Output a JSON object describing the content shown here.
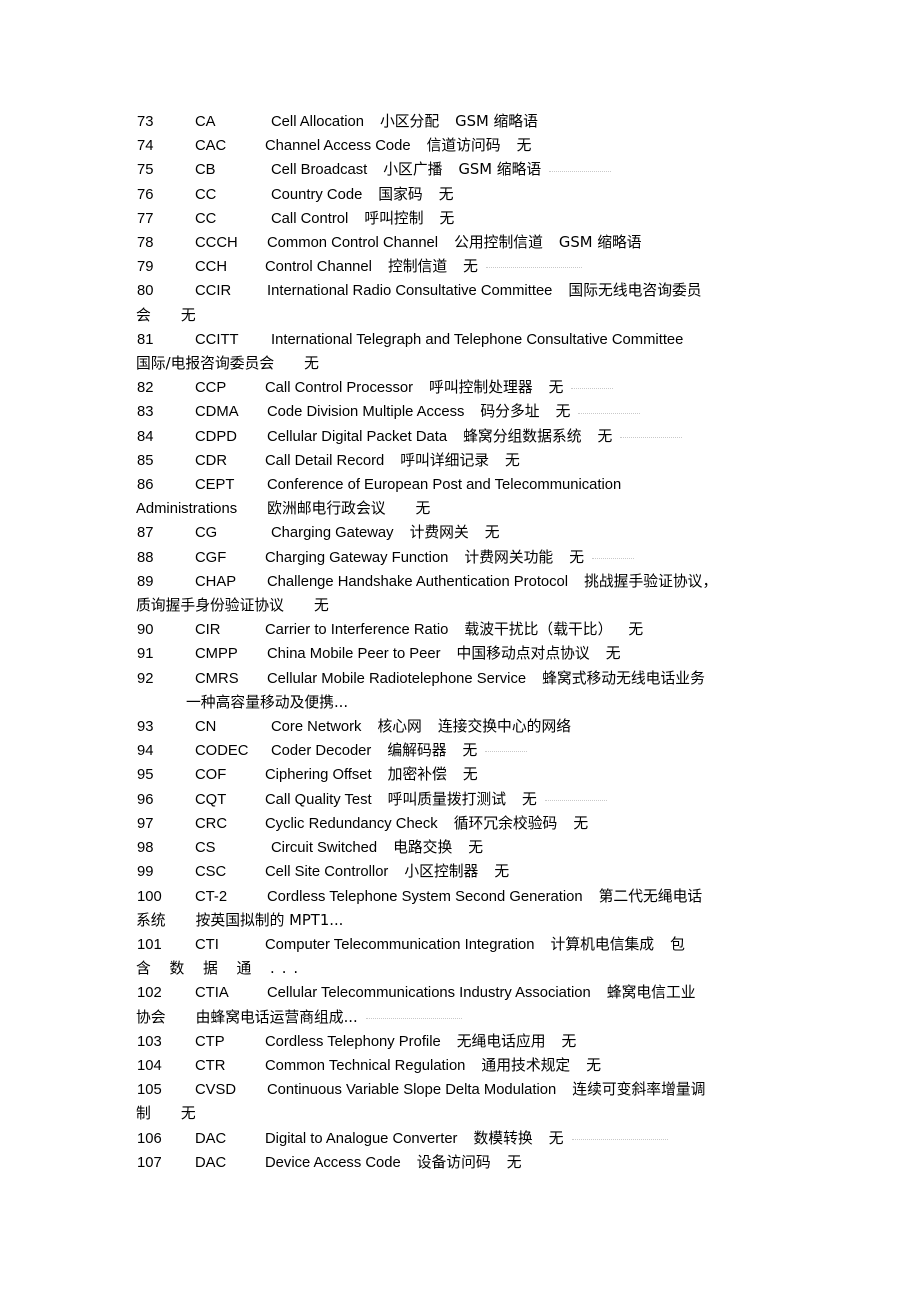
{
  "document": {
    "type": "glossary-table",
    "subject": "Telecommunications abbreviations with Chinese translations",
    "entries": [
      {
        "num": "73",
        "abbr": "CA",
        "english": "Cell Allocation",
        "chinese": "小区分配",
        "note": "GSM 缩略语",
        "abbr_width": "w2",
        "artifact": ""
      },
      {
        "num": "74",
        "abbr": "CAC",
        "english": "Channel Access Code",
        "chinese": "信道访问码",
        "note": "无",
        "abbr_width": "w3",
        "artifact": ""
      },
      {
        "num": "75",
        "abbr": "CB",
        "english": "Cell Broadcast",
        "chinese": "小区广播",
        "note": "GSM 缩略语",
        "abbr_width": "w2",
        "artifact": "a-md"
      },
      {
        "num": "76",
        "abbr": "CC",
        "english": "Country Code",
        "chinese": "国家码",
        "note": "无",
        "abbr_width": "w2",
        "artifact": ""
      },
      {
        "num": "77",
        "abbr": "CC",
        "english": "Call Control",
        "chinese": "呼叫控制",
        "note": "无",
        "abbr_width": "w2",
        "artifact": ""
      },
      {
        "num": "78",
        "abbr": "CCCH",
        "english": "Common Control Channel",
        "chinese": "公用控制信道",
        "note": "GSM 缩略语",
        "abbr_width": "w4",
        "artifact": ""
      },
      {
        "num": "79",
        "abbr": "CCH",
        "english": "Control Channel",
        "chinese": "控制信道",
        "note": "无",
        "abbr_width": "w3",
        "artifact": "a-lg"
      },
      {
        "num": "80",
        "abbr": "CCIR",
        "english": "International Radio Consultative Committee",
        "chinese": "国际无线电咨询委员",
        "note": "",
        "abbr_width": "w4",
        "artifact": "",
        "wrap": {
          "zh": "会",
          "note": "无",
          "indent": ""
        }
      },
      {
        "num": "81",
        "abbr": "CCITT",
        "english": "International Telegraph and Telephone Consultative Committee",
        "chinese": "",
        "note": "",
        "abbr_width": "w5",
        "artifact": "",
        "wrap": {
          "zh": "国际/电报咨询委员会",
          "note": "无",
          "indent": ""
        }
      },
      {
        "num": "82",
        "abbr": "CCP",
        "english": "Call Control Processor",
        "chinese": "呼叫控制处理器",
        "note": "无",
        "abbr_width": "w3",
        "artifact": "a-sm"
      },
      {
        "num": "83",
        "abbr": "CDMA",
        "english": "Code Division Multiple Access",
        "chinese": "码分多址",
        "note": "无",
        "abbr_width": "w4",
        "artifact": "a-md"
      },
      {
        "num": "84",
        "abbr": "CDPD",
        "english": "Cellular Digital Packet Data",
        "chinese": "蜂窝分组数据系统",
        "note": "无",
        "abbr_width": "w4",
        "artifact": "a-md"
      },
      {
        "num": "85",
        "abbr": "CDR",
        "english": "Call Detail Record",
        "chinese": "呼叫详细记录",
        "note": "无",
        "abbr_width": "w3",
        "artifact": ""
      },
      {
        "num": "86",
        "abbr": "CEPT",
        "english": "Conference of European Post and Telecommunication",
        "chinese": "",
        "note": "",
        "abbr_width": "w4",
        "artifact": "",
        "wrap": {
          "en": "Administrations",
          "zh": "欧洲邮电行政会议",
          "note": "无",
          "indent": ""
        }
      },
      {
        "num": "87",
        "abbr": "CG",
        "english": "Charging Gateway",
        "chinese": "计费网关",
        "note": "无",
        "abbr_width": "w2",
        "artifact": ""
      },
      {
        "num": "88",
        "abbr": "CGF",
        "english": "Charging Gateway Function",
        "chinese": "计费网关功能",
        "note": "无",
        "abbr_width": "w3",
        "artifact": "a-sm"
      },
      {
        "num": "89",
        "abbr": "CHAP",
        "english": "Challenge Handshake Authentication Protocol",
        "chinese": "挑战握手验证协议，",
        "note": "",
        "abbr_width": "w4",
        "artifact": "",
        "wrap": {
          "zh": "质询握手身份验证协议",
          "note": "无",
          "indent": ""
        }
      },
      {
        "num": "90",
        "abbr": "CIR",
        "english": "Carrier to Interference Ratio",
        "chinese": "载波干扰比（载干比）",
        "note": "无",
        "abbr_width": "w3",
        "artifact": ""
      },
      {
        "num": "91",
        "abbr": "CMPP",
        "english": "China Mobile Peer to Peer",
        "chinese": "中国移动点对点协议",
        "note": "无",
        "abbr_width": "w4",
        "artifact": ""
      },
      {
        "num": "92",
        "abbr": "CMRS",
        "english": "Cellular Mobile Radiotelephone Service",
        "chinese": "蜂窝式移动无线电话业务",
        "note": "",
        "abbr_width": "w4",
        "artifact": "",
        "wrap": {
          "zh": "一种高容量移动及便携...",
          "note": "",
          "indent": "indent-sm"
        }
      },
      {
        "num": "93",
        "abbr": "CN",
        "english": "Core Network",
        "chinese": "核心网",
        "note": "连接交换中心的网络",
        "abbr_width": "w2",
        "artifact": ""
      },
      {
        "num": "94",
        "abbr": "CODEC",
        "english": "Coder Decoder",
        "chinese": "编解码器",
        "note": "无",
        "abbr_width": "w5",
        "artifact": "a-sm"
      },
      {
        "num": "95",
        "abbr": "COF",
        "english": "Ciphering Offset",
        "chinese": "加密补偿",
        "note": "无",
        "abbr_width": "w3",
        "artifact": ""
      },
      {
        "num": "96",
        "abbr": "CQT",
        "english": "Call Quality Test",
        "chinese": "呼叫质量拨打测试",
        "note": "无",
        "abbr_width": "w3",
        "artifact": "a-md"
      },
      {
        "num": "97",
        "abbr": "CRC",
        "english": "Cyclic Redundancy Check",
        "chinese": "循环冗余校验码",
        "note": "无",
        "abbr_width": "w3",
        "artifact": ""
      },
      {
        "num": "98",
        "abbr": "CS",
        "english": "Circuit Switched",
        "chinese": "电路交换",
        "note": "无",
        "abbr_width": "w2",
        "artifact": ""
      },
      {
        "num": "99",
        "abbr": "CSC",
        "english": "Cell Site Controllor",
        "chinese": "小区控制器",
        "note": "无",
        "abbr_width": "w3",
        "artifact": ""
      },
      {
        "num": "100",
        "abbr": "CT-2",
        "english": "Cordless Telephone System Second Generation",
        "chinese": "第二代无绳电话",
        "note": "",
        "abbr_width": "w4",
        "artifact": "",
        "wrap": {
          "zh": "系统",
          "note": "按英国拟制的 MPT1...",
          "indent": ""
        }
      },
      {
        "num": "101",
        "abbr": "CTI",
        "english": "Computer Telecommunication Integration",
        "chinese": "计算机电信集成",
        "note": "包",
        "abbr_width": "w3",
        "artifact": "",
        "wrap": {
          "zh_spread": "含 数 据 通 ...",
          "note": "",
          "indent": ""
        }
      },
      {
        "num": "102",
        "abbr": "CTIA",
        "english": "Cellular Telecommunications Industry Association",
        "chinese": "蜂窝电信工业",
        "note": "",
        "abbr_width": "w4",
        "artifact": "",
        "wrap": {
          "zh": "协会",
          "note": "由蜂窝电话运营商组成...",
          "indent": "",
          "artifact": "a-lg"
        }
      },
      {
        "num": "103",
        "abbr": "CTP",
        "english": "Cordless Telephony Profile",
        "chinese": "无绳电话应用",
        "note": "无",
        "abbr_width": "w3",
        "artifact": ""
      },
      {
        "num": "104",
        "abbr": "CTR",
        "english": "Common Technical Regulation",
        "chinese": "通用技术规定",
        "note": "无",
        "abbr_width": "w3",
        "artifact": ""
      },
      {
        "num": "105",
        "abbr": "CVSD",
        "english": "Continuous Variable Slope Delta Modulation",
        "chinese": "连续可变斜率增量调",
        "note": "",
        "abbr_width": "w4",
        "artifact": "",
        "wrap": {
          "zh": "制",
          "note": "无",
          "indent": ""
        }
      },
      {
        "num": "106",
        "abbr": "DAC",
        "english": "Digital to Analogue Converter",
        "chinese": "数模转换",
        "note": "无",
        "abbr_width": "w3",
        "artifact": "a-lg"
      },
      {
        "num": "107",
        "abbr": "DAC",
        "english": "Device Access Code",
        "chinese": "设备访问码",
        "note": "无",
        "abbr_width": "w3",
        "artifact": ""
      }
    ]
  }
}
